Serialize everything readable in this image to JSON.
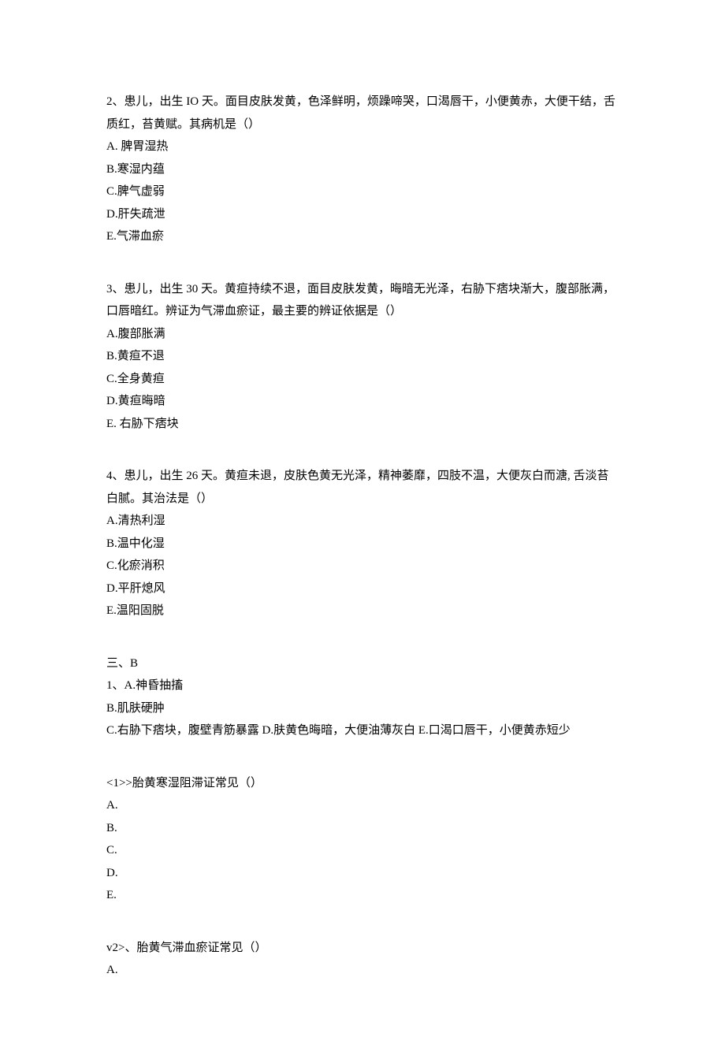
{
  "questions": [
    {
      "stem": "2、患儿，出生 IO 天。面目皮肤发黄，色泽鲜明，烦躁啼哭，口渴唇干，小便黄赤，大便干结，舌质红，苔黄赋。其病机是（）",
      "options": [
        "A. 脾胃湿热",
        "B.寒湿内蕴",
        "C.脾气虚弱",
        "D.肝失疏泄",
        "E.气滞血瘀"
      ]
    },
    {
      "stem": "3、患儿，出生 30 天。黄疸持续不退，面目皮肤发黄，晦暗无光泽，右胁下痞块渐大，腹部胀满，口唇暗红。辨证为气滞血瘀证，最主要的辨证依据是（）",
      "options": [
        "A.腹部胀满",
        "B.黄疸不退",
        "C.全身黄疸",
        "D.黄疸晦暗",
        "E. 右胁下痞块"
      ]
    },
    {
      "stem": "4、患儿，出生 26 天。黄疸未退，皮肤色黄无光泽，精神萎靡，四肢不温，大便灰白而溏, 舌淡苔白腻。其治法是（）",
      "options": [
        "A.清热利湿",
        "B.温中化湿",
        "C.化瘀消积",
        "D.平肝熄风",
        "E.温阳固脱"
      ]
    }
  ],
  "sectionB": {
    "header": "三、B",
    "sharedOptions": [
      "1、A.神昏抽搐",
      "B.肌肤硬肿",
      "C.右胁下痞块，腹壁青筋暴露 D.肤黄色晦暗，大便油薄灰白 E.口渴口唇干，小便黄赤短少"
    ],
    "subQuestions": [
      {
        "stem": "<1>>胎黄寒湿阻滞证常见（）",
        "options": [
          "A.",
          "B.",
          "C.",
          "D.",
          "E."
        ]
      },
      {
        "stem": "v2>、胎黄气滞血瘀证常见（）",
        "options": [
          "A."
        ]
      }
    ]
  }
}
